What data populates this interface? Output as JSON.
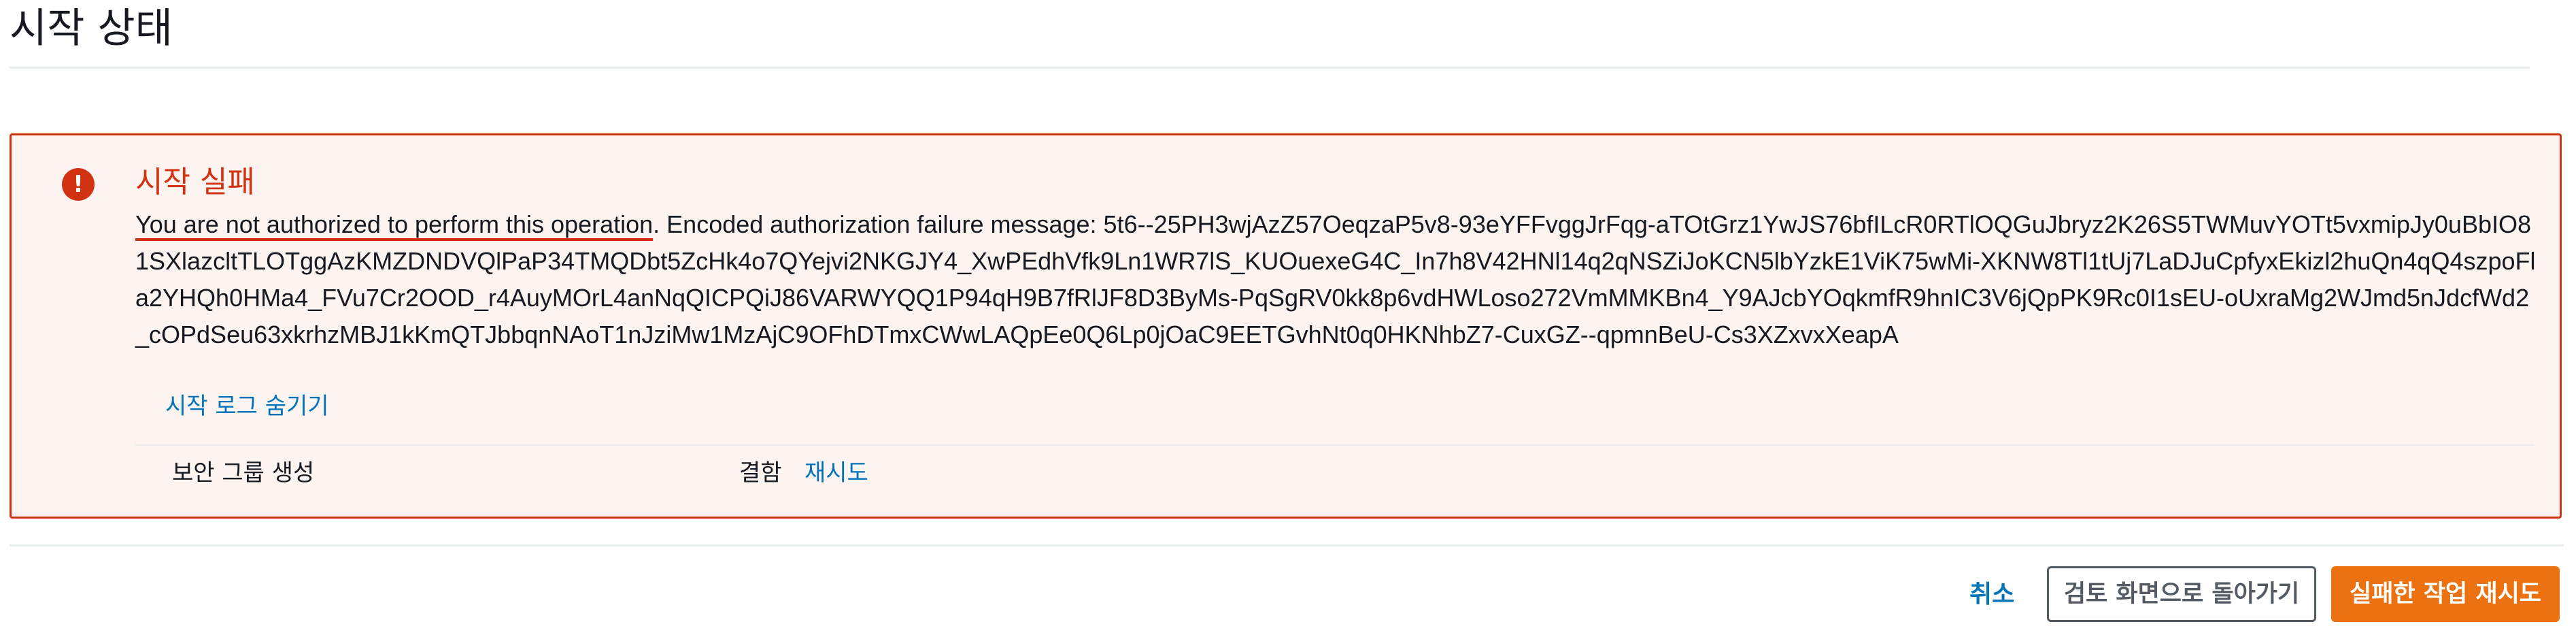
{
  "page": {
    "title": "시작 상태"
  },
  "error": {
    "heading": "시작 실패",
    "message_highlight": "You are not authorized to perform this operation",
    "message_rest": ". Encoded authorization failure message: 5t6--25PH3wjAzZ57OeqzaP5v8-93eYFFvggJrFqg-aTOtGrz1YwJS76bfILcR0RTlOQGuJbryz2K26S5TWMuvYOTt5vxmipJy0uBbIO81SXlazcltTLOTggAzKMZDNDVQlPaP34TMQDbt5ZcHk4o7QYejvi2NKGJY4_XwPEdhVfk9Ln1WR7lS_KUOuexeG4C_In7h8V42HNl14q2qNSZiJoKCN5lbYzkE1ViK75wMi-XKNW8Tl1tUj7LaDJuCpfyxEkizl2huQn4qQ4szpoFla2YHQh0HMa4_FVu7Cr2OOD_r4AuyMOrL4anNqQICPQiJ86VARWYQQ1P94qH9B7fRlJF8D3ByMs-PqSgRV0kk8p6vdHWLoso272VmMMKBn4_Y9AJcbYOqkmfR9hnIC3V6jQpPK9Rc0I1sEU-oUxraMg2WJmd5nJdcfWd2_cOPdSeu63xkrhzMBJ1kKmQTJbbqnNAoT1nJziMw1MzAjC9OFhDTmxCWwLAQpEe0Q6Lp0jOaC9EETGvhNt0q0HKNhbZ7-CuxGZ--qpmnBeU-Cs3XZxvxXeapA",
    "toggle_log_label": "시작 로그 숨기기",
    "steps": [
      {
        "name": "보안 그룹 생성",
        "status": "결함",
        "action": "재시도"
      }
    ]
  },
  "footer": {
    "cancel_label": "취소",
    "back_label": "검토 화면으로 돌아가기",
    "retry_failed_label": "실패한 작업 재시도"
  },
  "icons": {
    "error": "error-exclamation-icon"
  },
  "colors": {
    "error": "#d13212",
    "error_background": "#fdf3f1",
    "link": "#0073bb",
    "primary_button": "#ec7211"
  }
}
